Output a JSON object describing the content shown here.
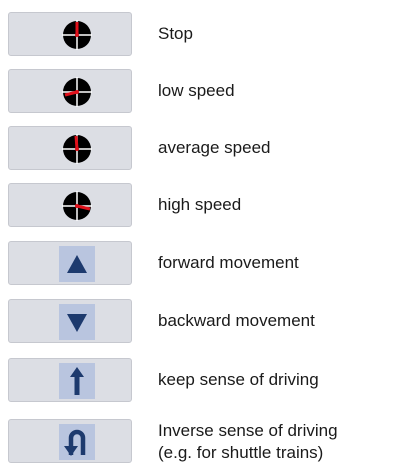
{
  "colors": {
    "tile_bg": "#dcdee4",
    "icon_bg": "#b9c5df",
    "dial_black": "#000000",
    "needle_red": "#e0101a",
    "arrow_blue": "#1d3a6e"
  },
  "legend": [
    {
      "icon": "speed-stop-icon",
      "label": "Stop"
    },
    {
      "icon": "speed-low-icon",
      "label": "low speed"
    },
    {
      "icon": "speed-average-icon",
      "label": "average speed"
    },
    {
      "icon": "speed-high-icon",
      "label": "high speed"
    },
    {
      "icon": "triangle-up-icon",
      "label": "forward movement"
    },
    {
      "icon": "triangle-down-icon",
      "label": "backward movement"
    },
    {
      "icon": "arrow-up-icon",
      "label": "keep sense of driving"
    },
    {
      "icon": "u-turn-icon",
      "label": "Inverse sense of driving",
      "label_2": "(e.g. for shuttle trains)"
    }
  ]
}
